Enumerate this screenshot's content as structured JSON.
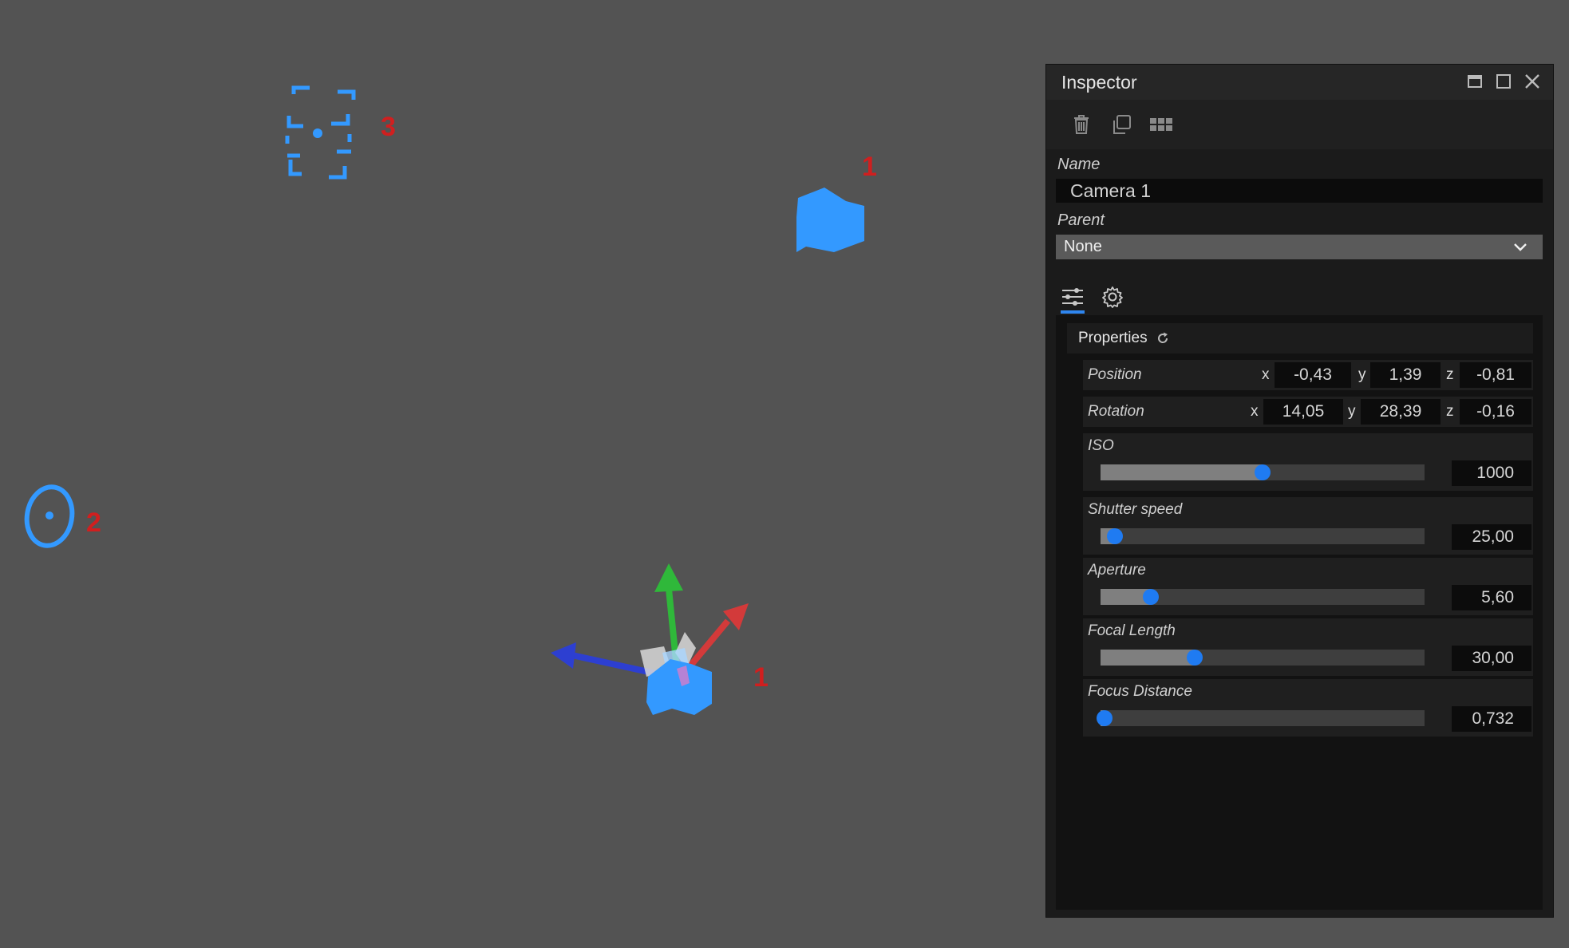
{
  "viewport": {
    "markers": [
      {
        "label": "3"
      },
      {
        "label": "1"
      },
      {
        "label": "2"
      },
      {
        "label": "1"
      }
    ]
  },
  "inspector": {
    "title": "Inspector",
    "name_label": "Name",
    "name_value": "Camera 1",
    "parent_label": "Parent",
    "parent_value": "None",
    "section_title": "Properties",
    "position": {
      "label": "Position",
      "x_label": "x",
      "x": "-0,43",
      "y_label": "y",
      "y": "1,39",
      "z_label": "z",
      "z": "-0,81"
    },
    "rotation": {
      "label": "Rotation",
      "x_label": "x",
      "x": "14,05",
      "y_label": "y",
      "y": "28,39",
      "z_label": "z",
      "z": "-0,16"
    },
    "sliders": [
      {
        "label": "ISO",
        "value": "1000",
        "fraction": 0.5
      },
      {
        "label": "Shutter speed",
        "value": "25,00",
        "fraction": 0.045
      },
      {
        "label": "Aperture",
        "value": "5,60",
        "fraction": 0.155
      },
      {
        "label": "Focal Length",
        "value": "30,00",
        "fraction": 0.29
      },
      {
        "label": "Focus Distance",
        "value": "0,732",
        "fraction": 0.012
      }
    ]
  },
  "colors": {
    "accent": "#1f7bf2",
    "marker_label": "#d01f1f",
    "gizmo_x": "#d33a3a",
    "gizmo_y": "#2fb83a",
    "gizmo_z": "#2d3fd1",
    "object": "#3399ff"
  },
  "icons": [
    "trash-icon",
    "duplicate-icon",
    "grid-icon",
    "minimize-icon",
    "maximize-icon",
    "close-icon",
    "chevron-down-icon",
    "sliders-icon",
    "gear-icon",
    "reset-icon"
  ]
}
